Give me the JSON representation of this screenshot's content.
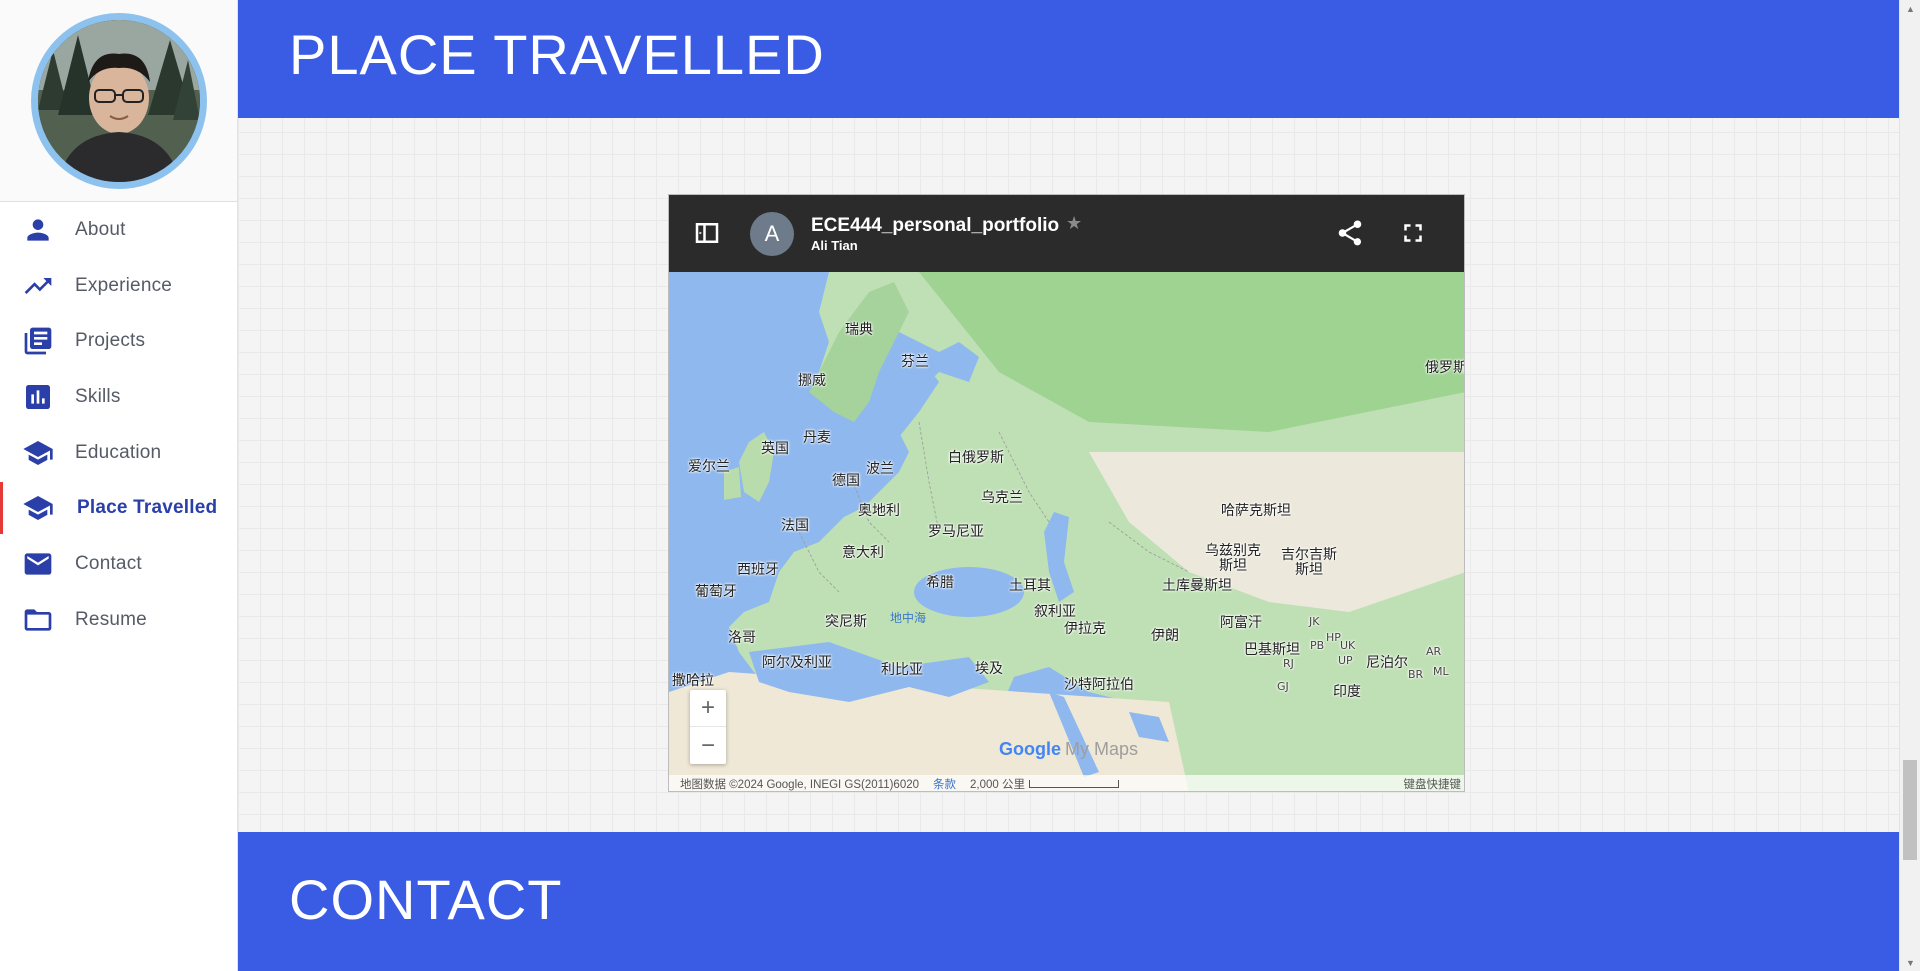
{
  "sidebar": {
    "avatar_alt": "profile photo",
    "items": [
      {
        "label": "About",
        "icon": "person-icon"
      },
      {
        "label": "Experience",
        "icon": "trending-up-icon"
      },
      {
        "label": "Projects",
        "icon": "library-books-icon"
      },
      {
        "label": "Skills",
        "icon": "bar-chart-icon"
      },
      {
        "label": "Education",
        "icon": "school-icon"
      },
      {
        "label": "Place Travelled",
        "icon": "school-icon",
        "active": true
      },
      {
        "label": "Contact",
        "icon": "mail-icon"
      },
      {
        "label": "Resume",
        "icon": "folder-icon"
      }
    ]
  },
  "sections": {
    "place_travelled_title": "PLACE TRAVELLED",
    "contact_title": "CONTACT"
  },
  "map": {
    "owner_initial": "A",
    "title": "ECE444_personal_portfolio",
    "owner": "Ali Tian",
    "labels": {
      "sweden": "瑞典",
      "finland": "芬兰",
      "norway": "挪威",
      "russia": "俄罗斯",
      "denmark": "丹麦",
      "uk": "英国",
      "ireland": "爱尔兰",
      "belarus": "白俄罗斯",
      "poland": "波兰",
      "germany": "德国",
      "ukraine": "乌克兰",
      "austria": "奥地利",
      "kazakhstan": "哈萨克斯坦",
      "france": "法国",
      "romania": "罗马尼亚",
      "italy": "意大利",
      "uzbekistan_1": "乌兹别克",
      "uzbekistan_2": "斯坦",
      "kyrgyzstan_1": "吉尔吉斯",
      "kyrgyzstan_2": "斯坦",
      "spain": "西班牙",
      "portugal": "葡萄牙",
      "greece": "希腊",
      "turkey": "土耳其",
      "turkmenistan": "土库曼斯坦",
      "tunisia": "突尼斯",
      "mediterranean": "地中海",
      "syria": "叙利亚",
      "iraq": "伊拉克",
      "iran": "伊朗",
      "afghanistan": "阿富汗",
      "morocco": "洛哥",
      "algeria": "阿尔及利亚",
      "libya": "利比亚",
      "egypt": "埃及",
      "pakistan": "巴基斯坦",
      "nepal": "尼泊尔",
      "saudi": "沙特阿拉伯",
      "western_sahara": "撒哈拉",
      "india": "印度",
      "uk_small": "UK",
      "pb_small": "PB",
      "up_small": "UP",
      "br_small": "BR",
      "ml_small": "ML",
      "rj_small": "RJ",
      "gj_small": "GJ",
      "ar_small": "AR",
      "jk_small": "JK",
      "hp_small": "HP"
    },
    "zoom_in": "+",
    "zoom_out": "−",
    "brand_google": "Google",
    "brand_mymaps": "My Maps",
    "attribution": "地图数据 ©2024 Google, INEGI GS(2011)6020",
    "terms": "条款",
    "scale": "2,000 公里",
    "shortcuts": "键盘快捷键"
  },
  "colors": {
    "banner": "#3a5ce4",
    "accent": "#2a3fa8",
    "active_marker": "#e53935"
  }
}
